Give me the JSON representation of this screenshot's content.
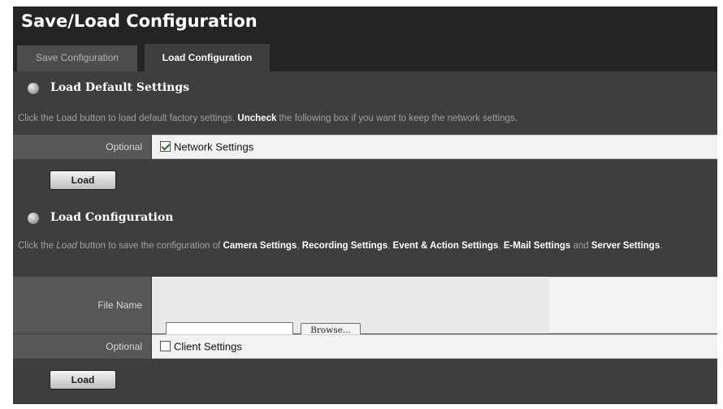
{
  "page": {
    "title": "Save/Load Configuration"
  },
  "tabs": [
    {
      "label": "Save Configuration",
      "active": false
    },
    {
      "label": "Load Configuration",
      "active": true
    }
  ],
  "load_default": {
    "title": "Load Default Settings",
    "desc_pre": "Click the Load button to load default factory settings. ",
    "desc_bold": "Uncheck",
    "desc_post": " the following box if you want to keep the network settings.",
    "optional_label": "Optional",
    "network_checkbox_label": "Network Settings",
    "network_checked": true,
    "load_button": "Load"
  },
  "load_config": {
    "title": "Load Configuration",
    "desc_1": "Click the ",
    "desc_load": "Load",
    "desc_2": " button to save the configuration of ",
    "desc_camera": "Camera Settings",
    "desc_sep1": ", ",
    "desc_recording": "Recording Settings",
    "desc_sep2": ", ",
    "desc_event": "Event & Action Settings",
    "desc_sep3": ", ",
    "desc_email": "E-Mail Settings",
    "desc_and": " and ",
    "desc_server": "Server Settings",
    "desc_end": ".",
    "file_name_label": "File Name",
    "file_value": "",
    "browse_button": "Browse...",
    "optional_label": "Optional",
    "client_checkbox_label": "Client Settings",
    "client_checked": false,
    "load_button": "Load"
  }
}
